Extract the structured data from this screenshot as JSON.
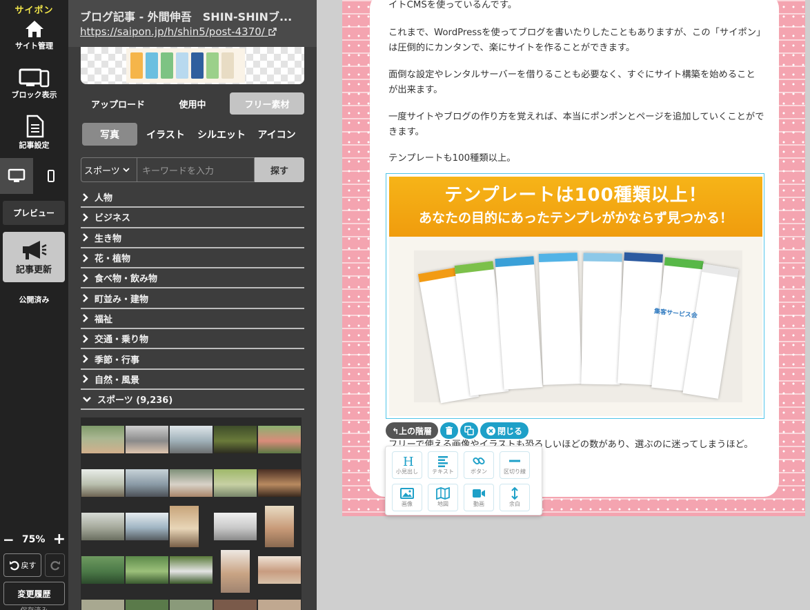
{
  "sidebar": {
    "logo": "サイポン",
    "site_admin": "サイト管理",
    "block_display": "ブロック表示",
    "article_settings": "記事設定",
    "preview": "プレビュー",
    "publish": "記事更新",
    "publish_status": "公開済み",
    "zoom": "75%",
    "undo": "戻す",
    "history": "変更履歴",
    "saved": "保存済み"
  },
  "panel": {
    "title": "ブログ記事 - 外間伸吾　SHIN-SHINブ...",
    "url": "https://saipon.jp/h/shin5/post-4370/",
    "tabs": [
      "アップロード",
      "使用中",
      "フリー素材"
    ],
    "active_tab": "フリー素材",
    "subtabs": [
      "写真",
      "イラスト",
      "シルエット",
      "アイコン"
    ],
    "active_subtab": "写真",
    "select_value": "スポーツ",
    "search_placeholder": "キーワードを入力",
    "search_button": "探す",
    "categories": [
      "人物",
      "ビジネス",
      "生き物",
      "花・植物",
      "食べ物・飲み物",
      "町並み・建物",
      "福祉",
      "交通・乗り物",
      "季節・行事",
      "自然・風景"
    ],
    "expanded_category": "スポーツ (9,236)"
  },
  "article": {
    "p0": "イトCMSを使っているんです。",
    "p1": "これまで、WordPressを使ってブログを書いたりしたこともありますが、この「サイポン」は圧倒的にカンタンで、楽にサイトを作ることができます。",
    "p2": "面倒な設定やレンタルサーバーを借りることも必要なく、すぐにサイト構築を始めることが出来ます。",
    "p3": "一度サイトやブログの作り方を覚えれば、本当にポンポンとページを追加していくことができます。",
    "p4": "テンプレートも100種類以上。",
    "banner_line1": "テンプレートは100種類以上！",
    "banner_line2": "あなたの目的にあったテンプレがかならず見つかる！",
    "p5": "フリーで使える画像やイラストも恐ろしいほどの数があり、選ぶのに迷ってしまうほど。",
    "mock_text": "集客サービス会"
  },
  "block_toolbar": {
    "up": "↰上の階層",
    "close": "閉じる"
  },
  "add_panel": {
    "items": [
      "小見出し",
      "テキスト",
      "ボタン",
      "区切り線",
      "画像",
      "地図",
      "動画",
      "余白"
    ]
  },
  "colors": {
    "accent": "#1ea0c8",
    "banner": "#f09c0d",
    "canvas_bg": "#f4a4b0",
    "logo": "#f2e64a"
  }
}
